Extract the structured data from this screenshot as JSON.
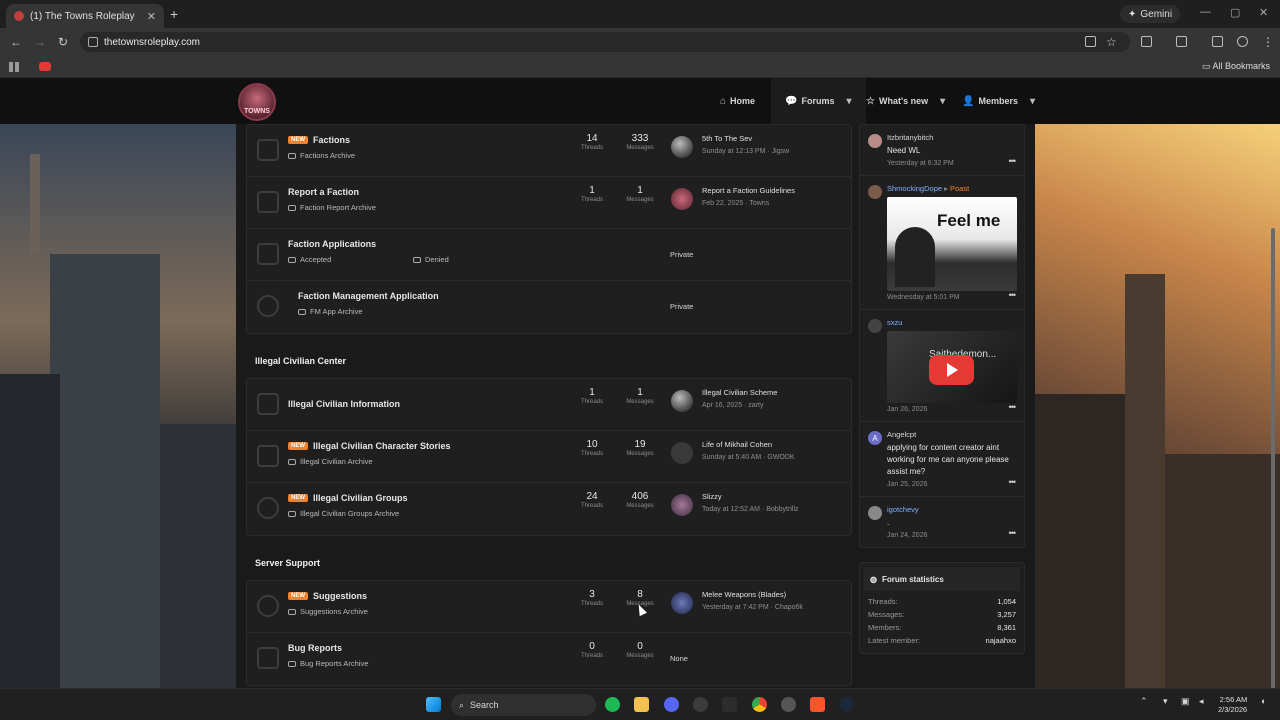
{
  "browser": {
    "tab_title": "(1) The Towns Roleplay",
    "tab_close": "✕",
    "new_tab": "+",
    "gemini_label": "Gemini",
    "url": "thetownsroleplay.com",
    "all_bookmarks": "All Bookmarks"
  },
  "site": {
    "logo_text": "TOWNS",
    "nav": {
      "home": "Home",
      "forums": "Forums",
      "whats_new": "What's new",
      "members": "Members"
    }
  },
  "forums": {
    "threads_label": "Threads",
    "messages_label": "Messages",
    "new_badge": "NEW",
    "faction_nodes": [
      {
        "title": "Factions",
        "new": true,
        "sub": "Factions Archive",
        "threads": "14",
        "messages": "333",
        "last_title": "5th To The Sev",
        "last_meta": "Sunday at 12:13 PM · Jigsw"
      },
      {
        "title": "Report a Faction",
        "new": false,
        "sub": "Faction Report Archive",
        "threads": "1",
        "messages": "1",
        "last_title": "Report a Faction Guidelines",
        "last_meta": "Feb 22, 2025 · Towns"
      },
      {
        "title": "Faction Applications",
        "new": false,
        "sub": "Accepted",
        "sub2": "Denied",
        "private": "Private"
      },
      {
        "title": "Faction Management Application",
        "new": false,
        "sub": "FM App Archive",
        "private": "Private"
      }
    ],
    "illegal_header": "Illegal Civilian Center",
    "illegal_nodes": [
      {
        "title": "Illegal Civilian Information",
        "new": false,
        "threads": "1",
        "messages": "1",
        "last_title": "Illegal Civilian Scheme",
        "last_meta": "Apr 16, 2025 · zarty"
      },
      {
        "title": "Illegal Civilian Character Stories",
        "new": true,
        "sub": "Illegal Civilian Archive",
        "threads": "10",
        "messages": "19",
        "last_title": "Life of Mikhail Cohen",
        "last_meta": "Sunday at 5:40 AM · GWODK"
      },
      {
        "title": "Illegal Civilian Groups",
        "new": true,
        "sub": "Illegal Civilian Groups Archive",
        "threads": "24",
        "messages": "406",
        "last_title": "Slizzy",
        "last_meta": "Today at 12:52 AM · Bobbytrillz"
      }
    ],
    "support_header": "Server Support",
    "support_nodes": [
      {
        "title": "Suggestions",
        "new": true,
        "sub": "Suggestions Archive",
        "threads": "3",
        "messages": "8",
        "last_title": "Melee Weapons (Blades)",
        "last_meta": "Yesterday at 7:42 PM · Chapo6k"
      },
      {
        "title": "Bug Reports",
        "new": false,
        "sub": "Bug Reports Archive",
        "threads": "0",
        "messages": "0",
        "none": "None"
      }
    ]
  },
  "sidebar": {
    "posts": [
      {
        "user": "Itzbritanybitch",
        "text": "Need WL",
        "date": "Yesterday at 6:32 PM"
      },
      {
        "user": "ShmockingDope",
        "arrow": "▸",
        "target": "Poast",
        "media_text": "Feel me",
        "date": "Wednesday at 5:01 PM"
      },
      {
        "user": "sxzu",
        "media_text": "Saithedemon...",
        "date": "Jan 26, 2026"
      },
      {
        "user": "Angelcpt",
        "avatar_letter": "A",
        "text": "applying for content creator aint working for me can anyone please assist me?",
        "date": "Jan 25, 2026"
      },
      {
        "user": "igotchevy",
        "text": ".",
        "date": "Jan 24, 2026"
      }
    ],
    "more": "•••",
    "stats": {
      "title": "Forum statistics",
      "rows": [
        {
          "label": "Threads:",
          "value": "1,054"
        },
        {
          "label": "Messages:",
          "value": "3,257"
        },
        {
          "label": "Members:",
          "value": "8,361"
        },
        {
          "label": "Latest member:",
          "value": "najaahxo"
        }
      ]
    }
  },
  "taskbar": {
    "search": "Search",
    "time": "2:56 AM",
    "date": "2/3/2026"
  },
  "colors": {
    "accent_new": "#f0822b",
    "link_blue": "#7fb2ff",
    "youtube_red": "#e53935"
  }
}
